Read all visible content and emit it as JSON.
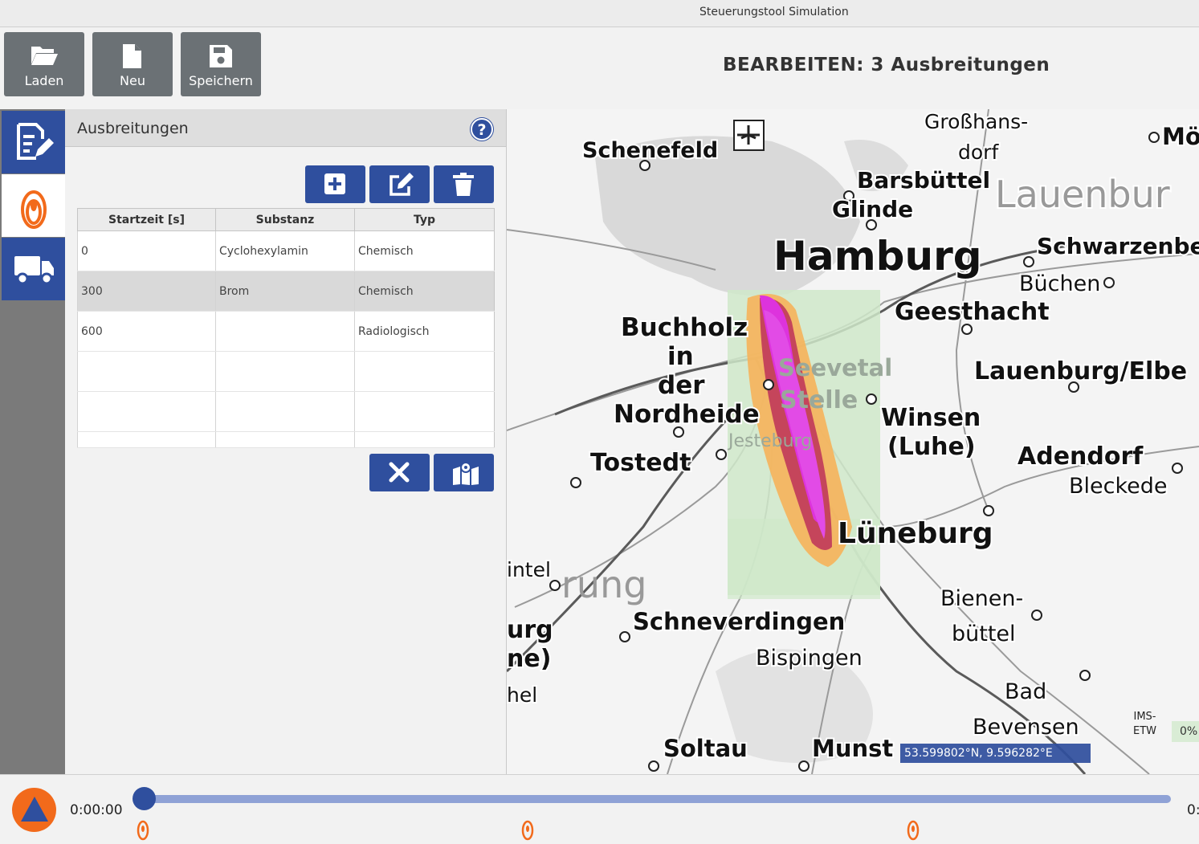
{
  "window": {
    "title": "Steuerungstool Simulation"
  },
  "toolbar": {
    "load_label": "Laden",
    "new_label": "Neu",
    "save_label": "Speichern",
    "headline": "BEARBEITEN: 3 Ausbreitungen"
  },
  "sidebar": {
    "tabs": [
      {
        "icon": "edit-document-icon"
      },
      {
        "icon": "dispersion-plume-icon",
        "active": true
      },
      {
        "icon": "truck-icon"
      }
    ]
  },
  "panel": {
    "title": "Ausbreitungen",
    "help": "?",
    "actions": [
      "add-icon",
      "edit-icon",
      "delete-icon"
    ],
    "columns": [
      "Startzeit [s]",
      "Substanz",
      "Typ"
    ],
    "rows": [
      {
        "start": "0",
        "substance": "Cyclohexylamin",
        "type": "Chemisch"
      },
      {
        "start": "300",
        "substance": "Brom",
        "type": "Chemisch"
      },
      {
        "start": "600",
        "substance": "",
        "type": "Radiologisch"
      }
    ],
    "selected_row": 1,
    "footer_actions": [
      "close-icon",
      "map-icon"
    ]
  },
  "map": {
    "labels": [
      "Schenefeld",
      "Großhans-",
      "dorf",
      "Barsbüttel",
      "Glinde",
      "Lauenbur",
      "Hamburg",
      "Schwarzenbe",
      "Büchen",
      "Geesthacht",
      "Buchholz",
      "in",
      "der",
      "Nordheide",
      "Seevetal",
      "Stelle",
      "Jesteburg",
      "Winsen",
      "(Luhe)",
      "Lauenburg/Elbe",
      "Tostedt",
      "Adendorf",
      "Bleckede",
      "Lüneburg",
      "rung",
      "intel",
      "urg",
      "ne)",
      "hel",
      "Schneverdingen",
      "Bienen-",
      "büttel",
      "Bispingen",
      "Bad",
      "Bevensen",
      "Soltau",
      "Munst",
      "Mö"
    ],
    "coordinates": "53.599802°N, 9.596282°E",
    "ims_label_1": "IMS-",
    "ims_label_2": "ETW",
    "ims_value": "0%"
  },
  "timeline": {
    "current": "0:00:00",
    "end": "0:",
    "markers": 3
  }
}
